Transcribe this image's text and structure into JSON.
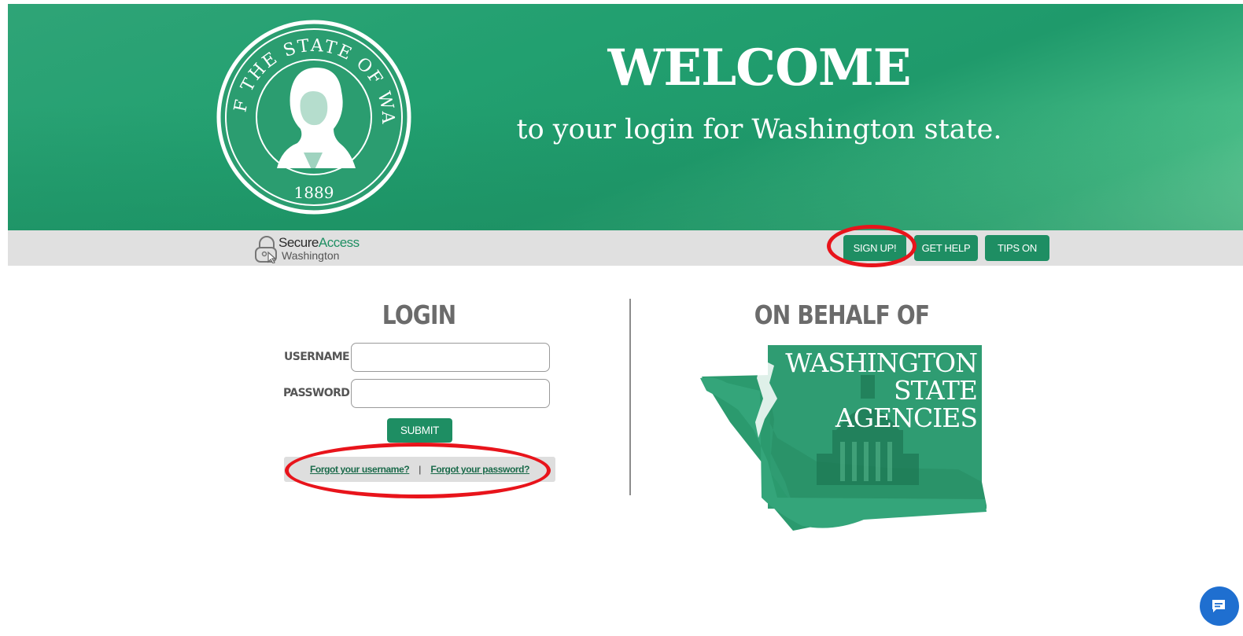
{
  "banner": {
    "seal_text": "THE SEAL OF THE STATE OF WASHINGTON 1889",
    "title": "WELCOME",
    "subtitle": "to your login for Washington state."
  },
  "nav": {
    "brand_name_part1": "Secure",
    "brand_name_part2": "Access",
    "brand_sub": "Washington",
    "buttons": {
      "signup": "SIGN UP!",
      "help": "GET HELP",
      "tips": "TIPS ON"
    }
  },
  "login": {
    "heading": "LOGIN",
    "username_label": "USERNAME",
    "username_value": "",
    "password_label": "PASSWORD",
    "password_value": "",
    "submit": "SUBMIT",
    "forgot_username": "Forgot your username?",
    "separator": "|",
    "forgot_password": "Forgot your password?"
  },
  "behalf": {
    "heading": "ON BEHALF OF",
    "line1": "WASHINGTON",
    "line2": "STATE",
    "line3": "AGENCIES"
  },
  "colors": {
    "brand_green": "#1e8e63",
    "annotation_red": "#e8141b",
    "chat_blue": "#1f6fd0"
  },
  "icons": {
    "brand": "padlock-cursor-icon",
    "chat": "chat-bubble-icon"
  }
}
